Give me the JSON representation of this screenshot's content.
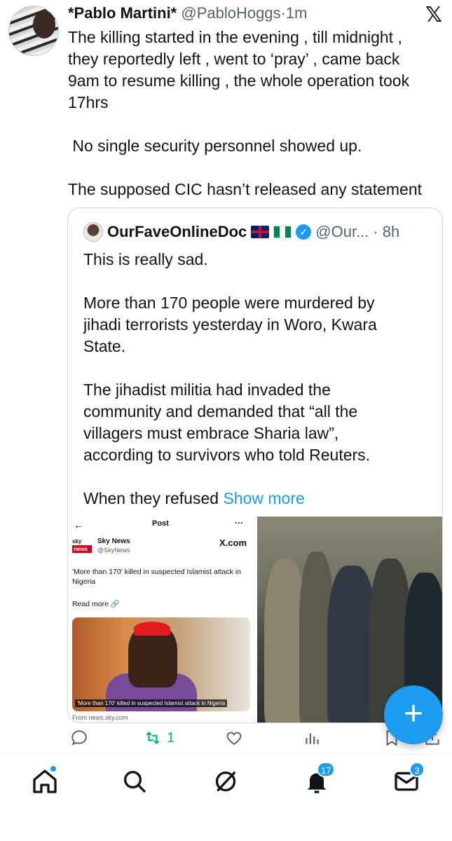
{
  "tweet": {
    "author_name": "*Pablo Martini*",
    "author_handle": "@PabloHoggs",
    "separator": "·",
    "time": "1m",
    "lines": [
      "The killing started in the evening , till midnight ,",
      "they reportedly left , went to ‘pray’ , came back",
      "9am to resume killing , the whole operation took",
      "17hrs"
    ],
    "para2": " No single security personnel showed up.",
    "para3": "The supposed CIC hasn’t released any statement"
  },
  "quote": {
    "name": "OurFaveOnlineDoc",
    "handle": "@Our...",
    "separator": "·",
    "time": "8h",
    "p1": "This is really sad.",
    "p2_lines": [
      "More than 170 people were murdered by",
      "jihadi terrorists yesterday in Woro, Kwara",
      "State."
    ],
    "p3_lines": [
      "The jihadist militia had invaded the",
      "community and demanded that “all the",
      "villagers must embrace Sharia law”,",
      "according to survivors who told Reuters."
    ],
    "p4": "When they refused ",
    "show_more": "Show more",
    "media_left": {
      "top_title": "Post",
      "sky_logo_top": "sky",
      "sky_logo_bottom": "news",
      "source_name": "Sky News",
      "source_handle": "@SkyNews",
      "platform": "X.com",
      "headline": "'More than 170' killed in suspected Islamist attack in Nigeria",
      "read_more": "Read more 🔗",
      "photo_caption": "'More than 170' killed in suspected Islamist attack in Nigeria",
      "from": "From news.sky.com"
    }
  },
  "actions": {
    "retweet_count": "1"
  },
  "bottom_nav": {
    "notifications_badge": "17",
    "messages_badge": "3"
  },
  "colors": {
    "accent": "#1d9bf0",
    "retweet_green": "#00ba7c",
    "muted": "#536471"
  }
}
